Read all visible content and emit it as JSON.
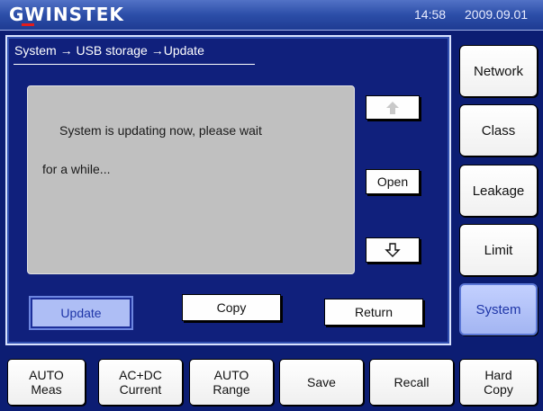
{
  "header": {
    "logo": "GWINSTEK",
    "time": "14:58",
    "date": "2009.09.01"
  },
  "breadcrumb": "System → USB storage →Update",
  "message": {
    "line1": "System is updating now, please wait",
    "line2": "for a while..."
  },
  "panel_buttons": {
    "up_icon": "up-arrow-icon",
    "open": "Open",
    "down_icon": "down-arrow-icon",
    "update": "Update",
    "copy": "Copy",
    "return": "Return"
  },
  "side_menu": [
    "Network",
    "Class",
    "Leakage",
    "Limit",
    "System"
  ],
  "bottom_bar": [
    {
      "line1": "AUTO",
      "line2": "Meas"
    },
    {
      "line1": "AC+DC",
      "line2": "Current"
    },
    {
      "line1": "AUTO",
      "line2": "Range"
    },
    {
      "line1": "Save",
      "line2": ""
    },
    {
      "line1": "Recall",
      "line2": ""
    },
    {
      "line1": "Hard",
      "line2": "Copy"
    }
  ],
  "colors": {
    "background": "#0c1d73",
    "accent": "#aebef5",
    "message_box": "#c0c0c0"
  }
}
